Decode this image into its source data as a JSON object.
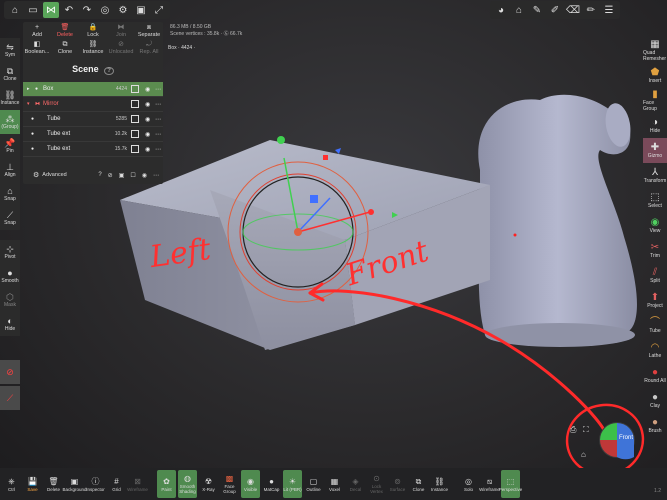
{
  "topbar": {
    "left_icons": [
      "home-icon",
      "folder-icon",
      "share-icon",
      "undo-icon",
      "redo-icon",
      "globe-icon",
      "gear-icon",
      "image-icon",
      "expand-icon"
    ],
    "right_icons": [
      "avatar-icon",
      "paint-icon",
      "pen-icon",
      "brush-icon",
      "eraser-icon",
      "brush-alt-icon",
      "menu-icon"
    ]
  },
  "stats": {
    "memory": "86.3 MB / 8.50 GB",
    "vertices": "Scene vertices : 35.8k · Ⓖ 66.7k"
  },
  "breadcrumb": {
    "object": "Box",
    "detail": "· 4424 ·"
  },
  "left_tools": [
    {
      "label": "Sym",
      "icon": "⇋"
    },
    {
      "label": "Clone",
      "icon": "⧉"
    },
    {
      "label": "Instance",
      "icon": "⛓"
    },
    {
      "label": "(Group)",
      "icon": "⁂",
      "active": true
    },
    {
      "label": "Pin",
      "icon": "📌"
    },
    {
      "label": "Align",
      "icon": "⊥"
    },
    {
      "label": "Snap",
      "icon": "⌂"
    },
    {
      "label": "Snap",
      "icon": "⟋"
    },
    {
      "label": "Pivot",
      "icon": "⊹"
    },
    {
      "label": "Smooth",
      "icon": "●"
    },
    {
      "label": "Mask",
      "icon": "⬡"
    },
    {
      "label": "Hide",
      "icon": "◐"
    }
  ],
  "right_tools": [
    {
      "label": "Quad Remesher",
      "icon": "▦"
    },
    {
      "label": "Insert",
      "icon": "⬟"
    },
    {
      "label": "Face Group",
      "icon": "▮"
    },
    {
      "label": "Hide",
      "icon": "◑"
    },
    {
      "label": "Gizmo",
      "icon": "✚",
      "highlight": true
    },
    {
      "label": "Transform",
      "icon": "⅄"
    },
    {
      "label": "Select",
      "icon": "⬚"
    },
    {
      "label": "View",
      "icon": "◉"
    },
    {
      "label": "Trim",
      "icon": "✂"
    },
    {
      "label": "Split",
      "icon": "⫽"
    },
    {
      "label": "Project",
      "icon": "⬆"
    },
    {
      "label": "Tube",
      "icon": "⌒"
    },
    {
      "label": "Lathe",
      "icon": "◠"
    },
    {
      "label": "Round All",
      "icon": "●"
    },
    {
      "label": "Clay",
      "icon": "●"
    },
    {
      "label": "Brush",
      "icon": "●"
    }
  ],
  "scene_panel": {
    "actions": [
      {
        "label": "Add",
        "icon": "+"
      },
      {
        "label": "Delete",
        "icon": "🗑",
        "danger": true
      },
      {
        "label": "Lock",
        "icon": "🔒"
      },
      {
        "label": "Join",
        "icon": "⧓",
        "dim": true
      },
      {
        "label": "Separate",
        "icon": "⧈"
      },
      {
        "label": "Boolean...",
        "icon": "◧"
      },
      {
        "label": "Clone",
        "icon": "⧉"
      },
      {
        "label": "Instance",
        "icon": "⛓"
      },
      {
        "label": "Unlocated",
        "icon": "⊘",
        "dim": true
      },
      {
        "label": "Rep. All",
        "icon": "⤾",
        "dim": true
      }
    ],
    "title": "Scene",
    "help_icon": "?",
    "rows": [
      {
        "name": "Box",
        "count": "4424",
        "selected": true,
        "indent": 0
      },
      {
        "name": "Mirror",
        "count": "",
        "selected": false,
        "indent": 0,
        "mirror": true
      },
      {
        "name": "Tube",
        "count": "5285",
        "selected": false,
        "indent": 1
      },
      {
        "name": "Tube ext",
        "count": "10.2k",
        "selected": false,
        "indent": 1
      },
      {
        "name": "Tube ext",
        "count": "15.7k",
        "selected": false,
        "indent": 1
      }
    ],
    "advanced_label": "Advanced"
  },
  "bottom_tools": [
    {
      "label": "Ctrl",
      "icon": "⎈"
    },
    {
      "label": "Save",
      "icon": "💾",
      "warn": true
    },
    {
      "label": "Delete",
      "icon": "🗑"
    },
    {
      "label": "Background",
      "icon": "▣"
    },
    {
      "label": "Inspector",
      "icon": "ⓘ"
    },
    {
      "label": "Grid",
      "icon": "#"
    },
    {
      "label": "Wireframe",
      "icon": "⊠",
      "dim": true
    },
    {
      "label": "Paint",
      "icon": "✿",
      "active": true
    },
    {
      "label": "Smooth Shading",
      "icon": "◍",
      "active": true
    },
    {
      "label": "X-Ray",
      "icon": "☢"
    },
    {
      "label": "Face Group",
      "icon": "▩"
    },
    {
      "label": "Visible",
      "icon": "◉",
      "active": true
    },
    {
      "label": "MatCap",
      "icon": "●"
    },
    {
      "label": "Lit (PBR)",
      "icon": "☀",
      "active": true
    },
    {
      "label": "Outline",
      "icon": "▢"
    },
    {
      "label": "Voxel",
      "icon": "▦"
    },
    {
      "label": "Decal",
      "icon": "◈",
      "dim": true
    },
    {
      "label": "Lock Vertex",
      "icon": "⊙",
      "dim": true
    },
    {
      "label": "Surface",
      "icon": "⊚",
      "dim": true
    },
    {
      "label": "Clone",
      "icon": "⧉"
    },
    {
      "label": "Instance",
      "icon": "⛓"
    },
    {
      "label": "Solo",
      "icon": "◎"
    },
    {
      "label": "Wireframe",
      "icon": "⧅"
    },
    {
      "label": "Perspective",
      "icon": "⬚",
      "active": true
    }
  ],
  "annotations": {
    "left": "Left",
    "front": "Front"
  },
  "view_cube": {
    "front_label": "Front"
  },
  "version": "1.2"
}
